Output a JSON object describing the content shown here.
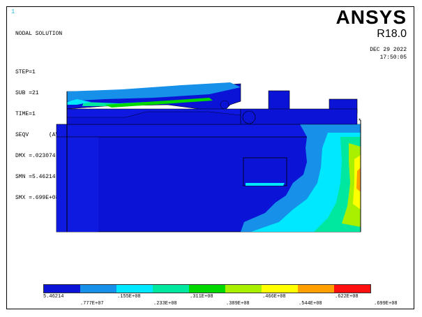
{
  "window_number": "1",
  "title": "NODAL SOLUTION",
  "info_lines": [
    "STEP=1",
    "SUB =21",
    "TIME=1",
    "SEQV      (AVG)",
    "DMX =.023074",
    "SMN =5.46214",
    "SMX =.699E+08"
  ],
  "logo": {
    "brand": "ANSYS",
    "version": "R18.0"
  },
  "date": "DEC 29 2022",
  "time": "17:50:05",
  "legend": {
    "colors": [
      "#0b13d6",
      "#1690e8",
      "#00e8ff",
      "#00e8a0",
      "#00d800",
      "#a8f000",
      "#ffff00",
      "#ffa000",
      "#ff1010"
    ],
    "labels_bottom": [
      "5.46214",
      ".155E+08",
      ".311E+08",
      ".466E+08",
      ".622E+08"
    ],
    "labels_top": [
      ".777E+07",
      ".233E+08",
      ".389E+08",
      ".544E+08",
      ".699E+08"
    ]
  }
}
